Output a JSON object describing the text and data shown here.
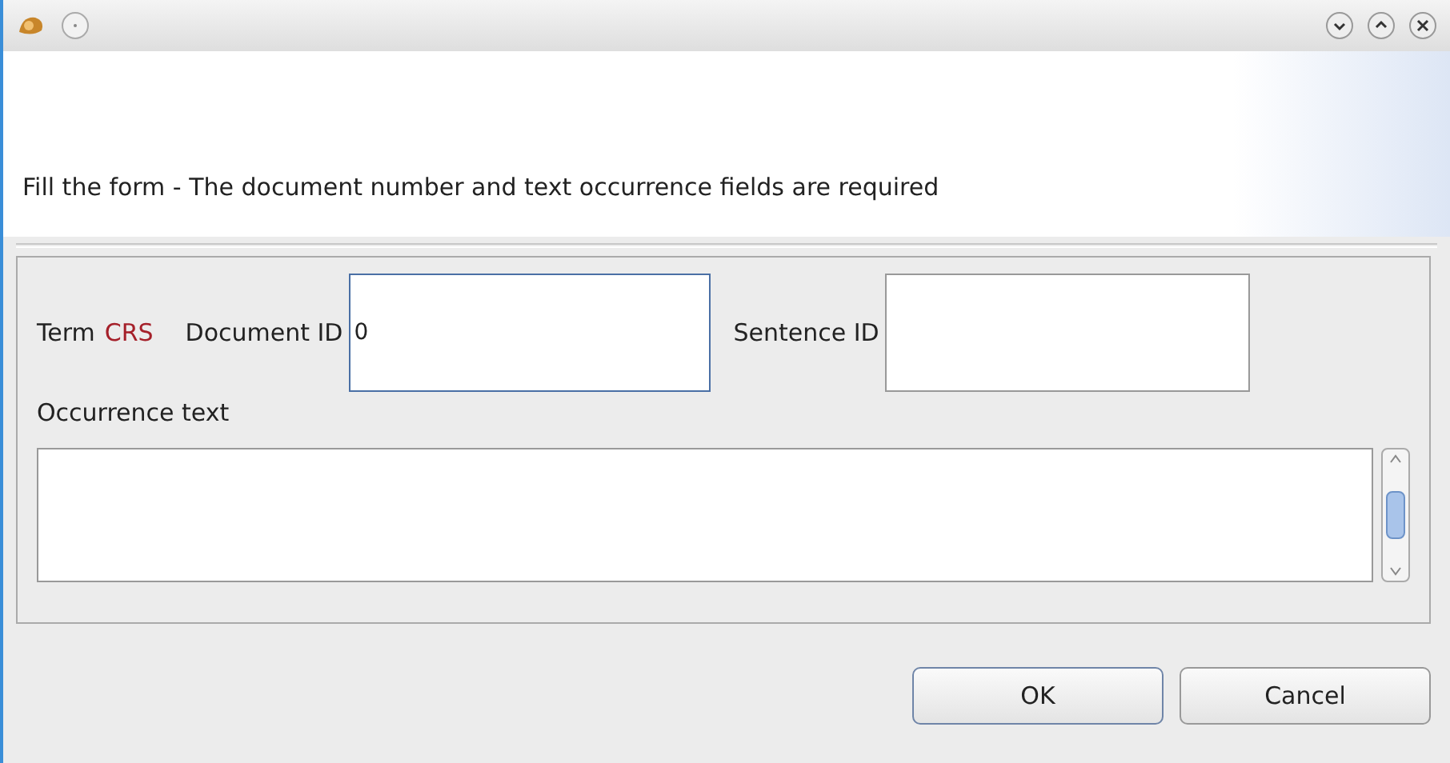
{
  "header": {
    "instruction": "Fill the form - The document number and text occurrence fields are required"
  },
  "form": {
    "term_label": "Term",
    "term_value": "CRS",
    "fields": [
      {
        "label": "Document ID",
        "value": "0",
        "focused": true
      },
      {
        "label": "Sentence ID",
        "focused": false
      }
    ],
    "occurrence_label": "Occurrence text"
  },
  "buttons": [
    {
      "label": "OK",
      "default": true
    },
    {
      "label": "Cancel",
      "default": false
    }
  ]
}
